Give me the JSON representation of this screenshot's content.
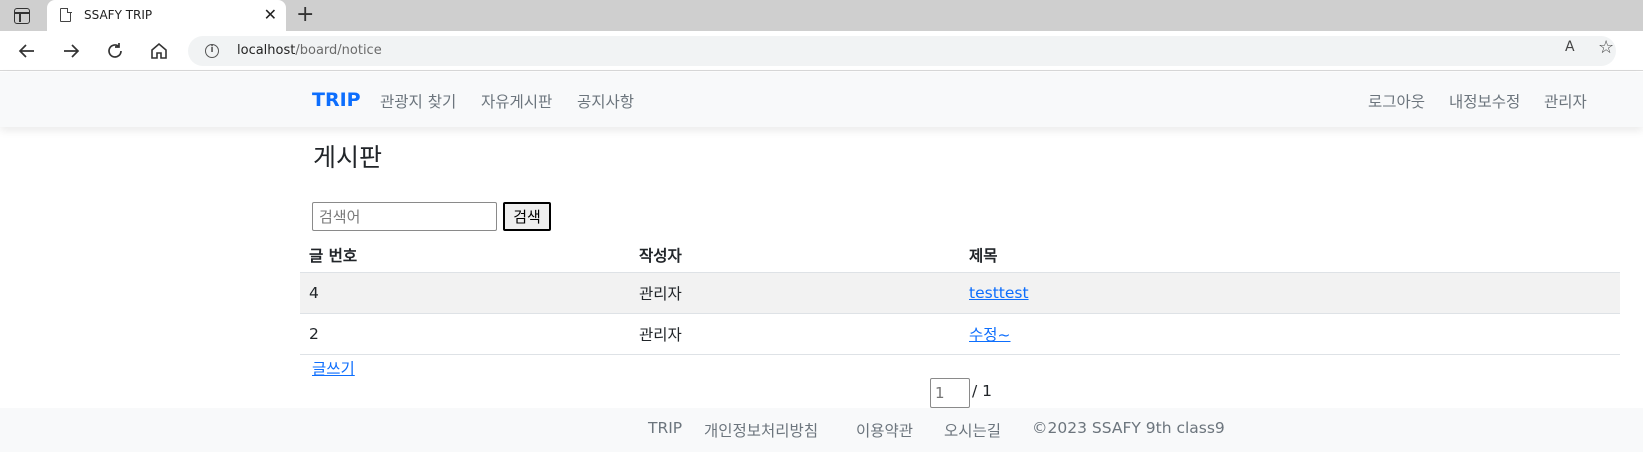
{
  "browser": {
    "tab_title": "SSAFY TRIP",
    "tab_close": "✕",
    "new_tab": "+",
    "url_host": "localhost",
    "url_path": "/board/notice",
    "read_aloud": "A",
    "favorites": "☆",
    "info": "i"
  },
  "nav": {
    "brand": "TRIP",
    "links": [
      "관광지 찾기",
      "자유게시판",
      "공지사항"
    ],
    "right_links": [
      "로그아웃",
      "내정보수정",
      "관리자"
    ]
  },
  "board": {
    "title": "게시판",
    "search_placeholder": "검색어",
    "search_button": "검색",
    "columns": [
      "글 번호",
      "작성자",
      "제목"
    ],
    "rows": [
      {
        "no": "4",
        "author": "관리자",
        "title": "testtest"
      },
      {
        "no": "2",
        "author": "관리자",
        "title": "수정~"
      }
    ],
    "write_link": "글쓰기",
    "page_current": "1",
    "page_total": "/ 1"
  },
  "footer": {
    "items": [
      "TRIP",
      "개인정보처리방침",
      "이용약관",
      "오시는길",
      "©2023 SSAFY 9th class9"
    ]
  }
}
